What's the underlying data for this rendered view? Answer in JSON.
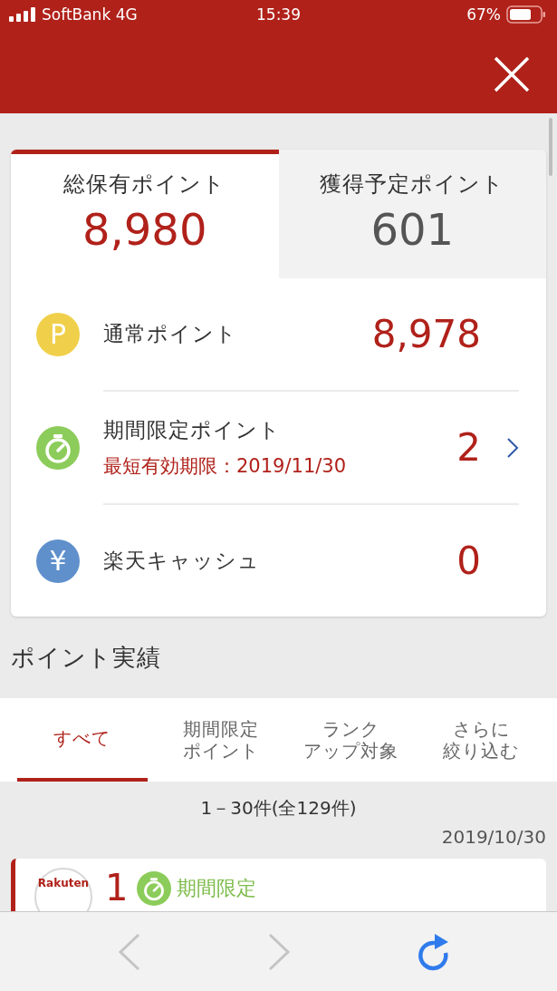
{
  "status_bar": {
    "carrier": "SoftBank 4G",
    "time": "15:39",
    "battery": "67%"
  },
  "summary_tabs": [
    {
      "label": "総保有ポイント",
      "value": "8,980",
      "selected": true
    },
    {
      "label": "獲得予定ポイント",
      "value": "601",
      "selected": false
    }
  ],
  "balances": [
    {
      "kind": "regular",
      "icon_text": "P",
      "label": "通常ポイント",
      "value": "8,978",
      "link": false
    },
    {
      "kind": "limited",
      "label": "期間限定ポイント",
      "note": "最短有効期限：2019/11/30",
      "value": "2",
      "link": true
    },
    {
      "kind": "cash",
      "icon_text": "¥",
      "label": "楽天キャッシュ",
      "value": "0",
      "link": false
    }
  ],
  "history": {
    "title": "ポイント実績",
    "filters": [
      {
        "lines": [
          "すべて"
        ],
        "selected": true
      },
      {
        "lines": [
          "期間限定",
          "ポイント"
        ],
        "selected": false
      },
      {
        "lines": [
          "ランク",
          "アップ対象"
        ],
        "selected": false
      },
      {
        "lines": [
          "さらに",
          "絞り込む"
        ],
        "selected": false
      }
    ],
    "count": "1－30件(全129件)",
    "date": "2019/10/30",
    "entries": [
      {
        "logo_lines": [
          "Rakuten"
        ],
        "points": "1",
        "tag": "期間限定"
      }
    ]
  },
  "toolbar": {
    "back_enabled": false,
    "forward_enabled": false
  }
}
